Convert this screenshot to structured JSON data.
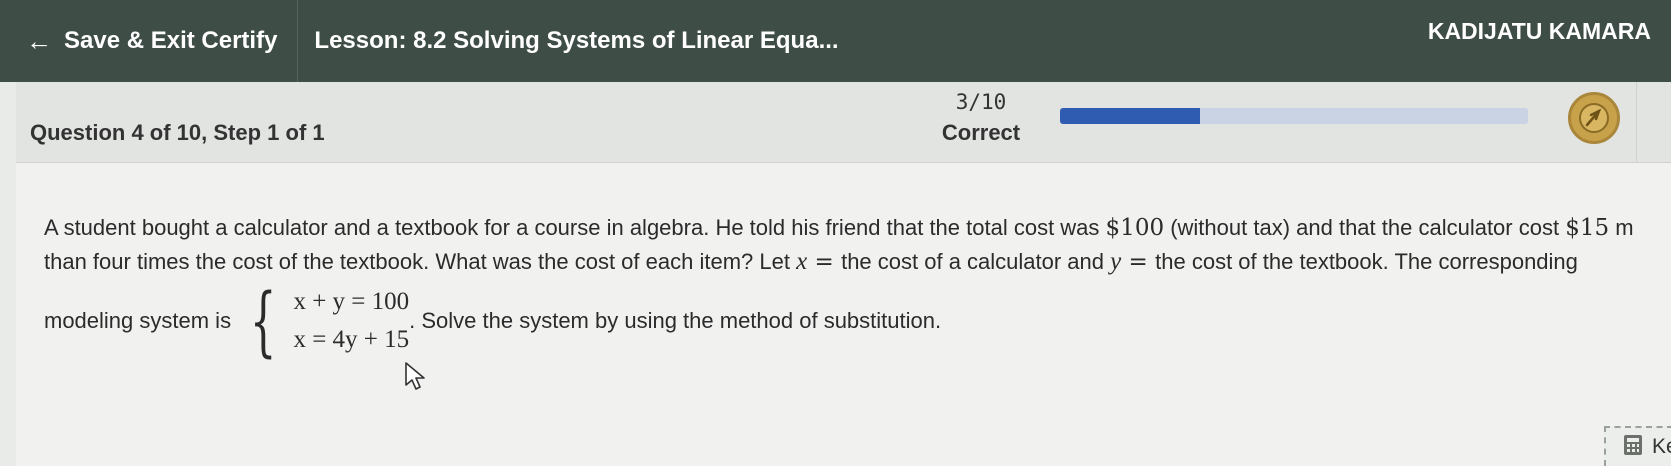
{
  "topbar": {
    "back_label": "Save & Exit Certify",
    "lesson_title": "Lesson: 8.2 Solving Systems of Linear Equa...",
    "user_name": "KADIJATU KAMARA"
  },
  "header": {
    "question_title": "Question 4 of 10, Step 1 of 1",
    "score_fraction": "3/10",
    "score_label": "Correct",
    "progress_value": 0.3,
    "badge_icon": "compass-badge-icon"
  },
  "problem": {
    "line1_a": "A student bought a calculator and a textbook for a course in algebra.  He told his friend that the total cost was ",
    "line1_total": "$100",
    "line1_b": " (without tax) and that the calculator cost ",
    "line1_cost": "$15",
    "line1_c": " m",
    "line2_a": "than four times the cost of the textbook.  What was the cost of each item?  Let ",
    "var_x": "x",
    "eq_sign": " = ",
    "line2_b": " the cost of a calculator and ",
    "var_y": "y",
    "line2_c": " the cost of the textbook.  The corresponding",
    "line3_a": "modeling system is ",
    "eq1": "x + y = 100",
    "eq2": "x = 4y + 15",
    "line3_b": ".  Solve the system by using the method of substitution."
  },
  "keypad": {
    "label": "Ke",
    "icon": "calculator-icon"
  },
  "colors": {
    "topbar_bg": "#3f4d47",
    "progress_fill": "#2f5bb0",
    "progress_track": "#c9d3e4",
    "badge": "#c8a24a"
  }
}
